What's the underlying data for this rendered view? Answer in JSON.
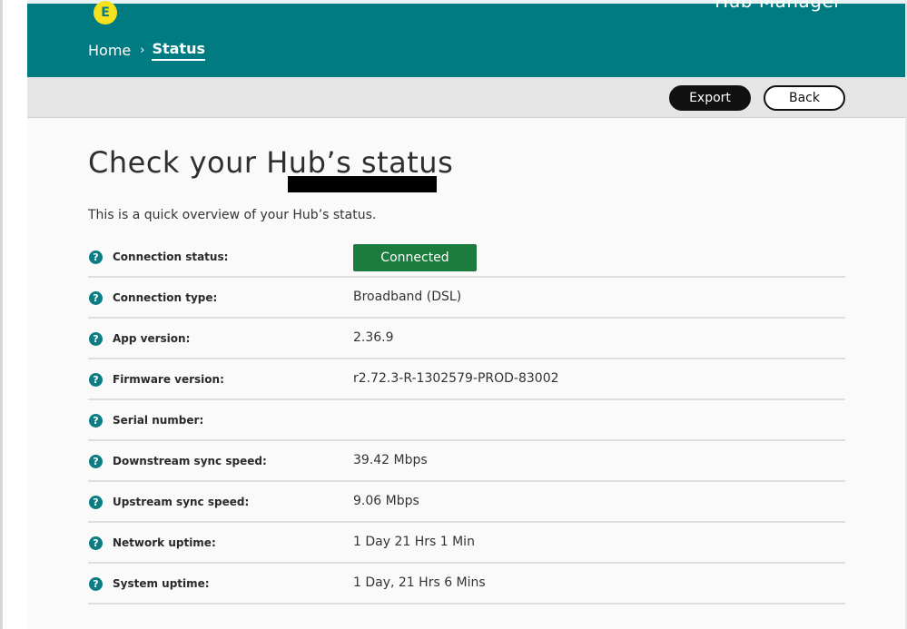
{
  "app": {
    "logo_letter": "E",
    "title": "Hub Manager"
  },
  "breadcrumb": {
    "home": "Home",
    "separator": "›",
    "current": "Status"
  },
  "toolbar": {
    "export_label": "Export",
    "back_label": "Back"
  },
  "page": {
    "title": "Check your Hub’s status",
    "intro": "This is a quick overview of your Hub’s status."
  },
  "status_rows": [
    {
      "label": "Connection status:",
      "value": "Connected",
      "kind": "badge"
    },
    {
      "label": "Connection type:",
      "value": "Broadband (DSL)"
    },
    {
      "label": "App version:",
      "value": "2.36.9"
    },
    {
      "label": "Firmware version:",
      "value": "r2.72.3-R-1302579-PROD-83002"
    },
    {
      "label": "Serial number:",
      "kind": "redacted"
    },
    {
      "label": "Downstream sync speed:",
      "value": "39.42 Mbps"
    },
    {
      "label": "Upstream sync speed:",
      "value": "9.06 Mbps"
    },
    {
      "label": "Network uptime:",
      "value": "1 Day 21 Hrs 1 Min"
    },
    {
      "label": "System uptime:",
      "value": "1 Day, 21 Hrs 6 Mins"
    }
  ],
  "help_icon_glyph": "?",
  "colors": {
    "header": "#007b82",
    "logo": "#f5e11d",
    "connected": "#1b7c3d",
    "help_icon": "#0d7d84"
  },
  "icons": {
    "help": "help-icon",
    "breadcrumb_separator": "chevron-right-icon"
  }
}
